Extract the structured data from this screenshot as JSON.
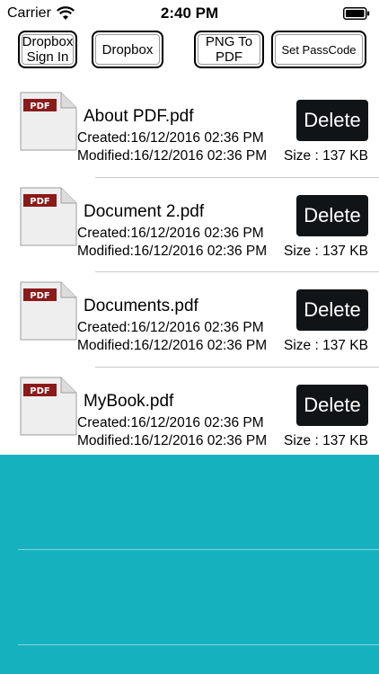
{
  "status_bar": {
    "carrier": "Carrier",
    "time": "2:40 PM"
  },
  "toolbar": {
    "dropbox_sign_in": "Dropbox\nSign In",
    "dropbox": "Dropbox",
    "png_to_pdf": "PNG To\nPDF",
    "set_passcode": "Set PassCode"
  },
  "files": [
    {
      "name": "About PDF.pdf",
      "created": "Created:16/12/2016 02:36 PM",
      "modified": "Modified:16/12/2016 02:36 PM",
      "size": "Size : 137 KB",
      "delete_label": "Delete",
      "thumb_label": "PDF"
    },
    {
      "name": "Document 2.pdf",
      "created": "Created:16/12/2016 02:36 PM",
      "modified": "Modified:16/12/2016 02:36 PM",
      "size": "Size : 137 KB",
      "delete_label": "Delete",
      "thumb_label": "PDF"
    },
    {
      "name": "Documents.pdf",
      "created": "Created:16/12/2016 02:36 PM",
      "modified": "Modified:16/12/2016 02:36 PM",
      "size": "Size : 137 KB",
      "delete_label": "Delete",
      "thumb_label": "PDF"
    },
    {
      "name": "MyBook.pdf",
      "created": "Created:16/12/2016 02:36 PM",
      "modified": "Modified:16/12/2016 02:36 PM",
      "size": "Size : 137 KB",
      "delete_label": "Delete",
      "thumb_label": "PDF"
    }
  ],
  "colors": {
    "delete_button": "#111417",
    "bottom_background": "#15b1bf",
    "pdf_badge": "#8b1a1a"
  },
  "icons": {
    "wifi": "wifi-icon",
    "battery": "battery-icon",
    "pdf": "pdf-file-icon"
  }
}
